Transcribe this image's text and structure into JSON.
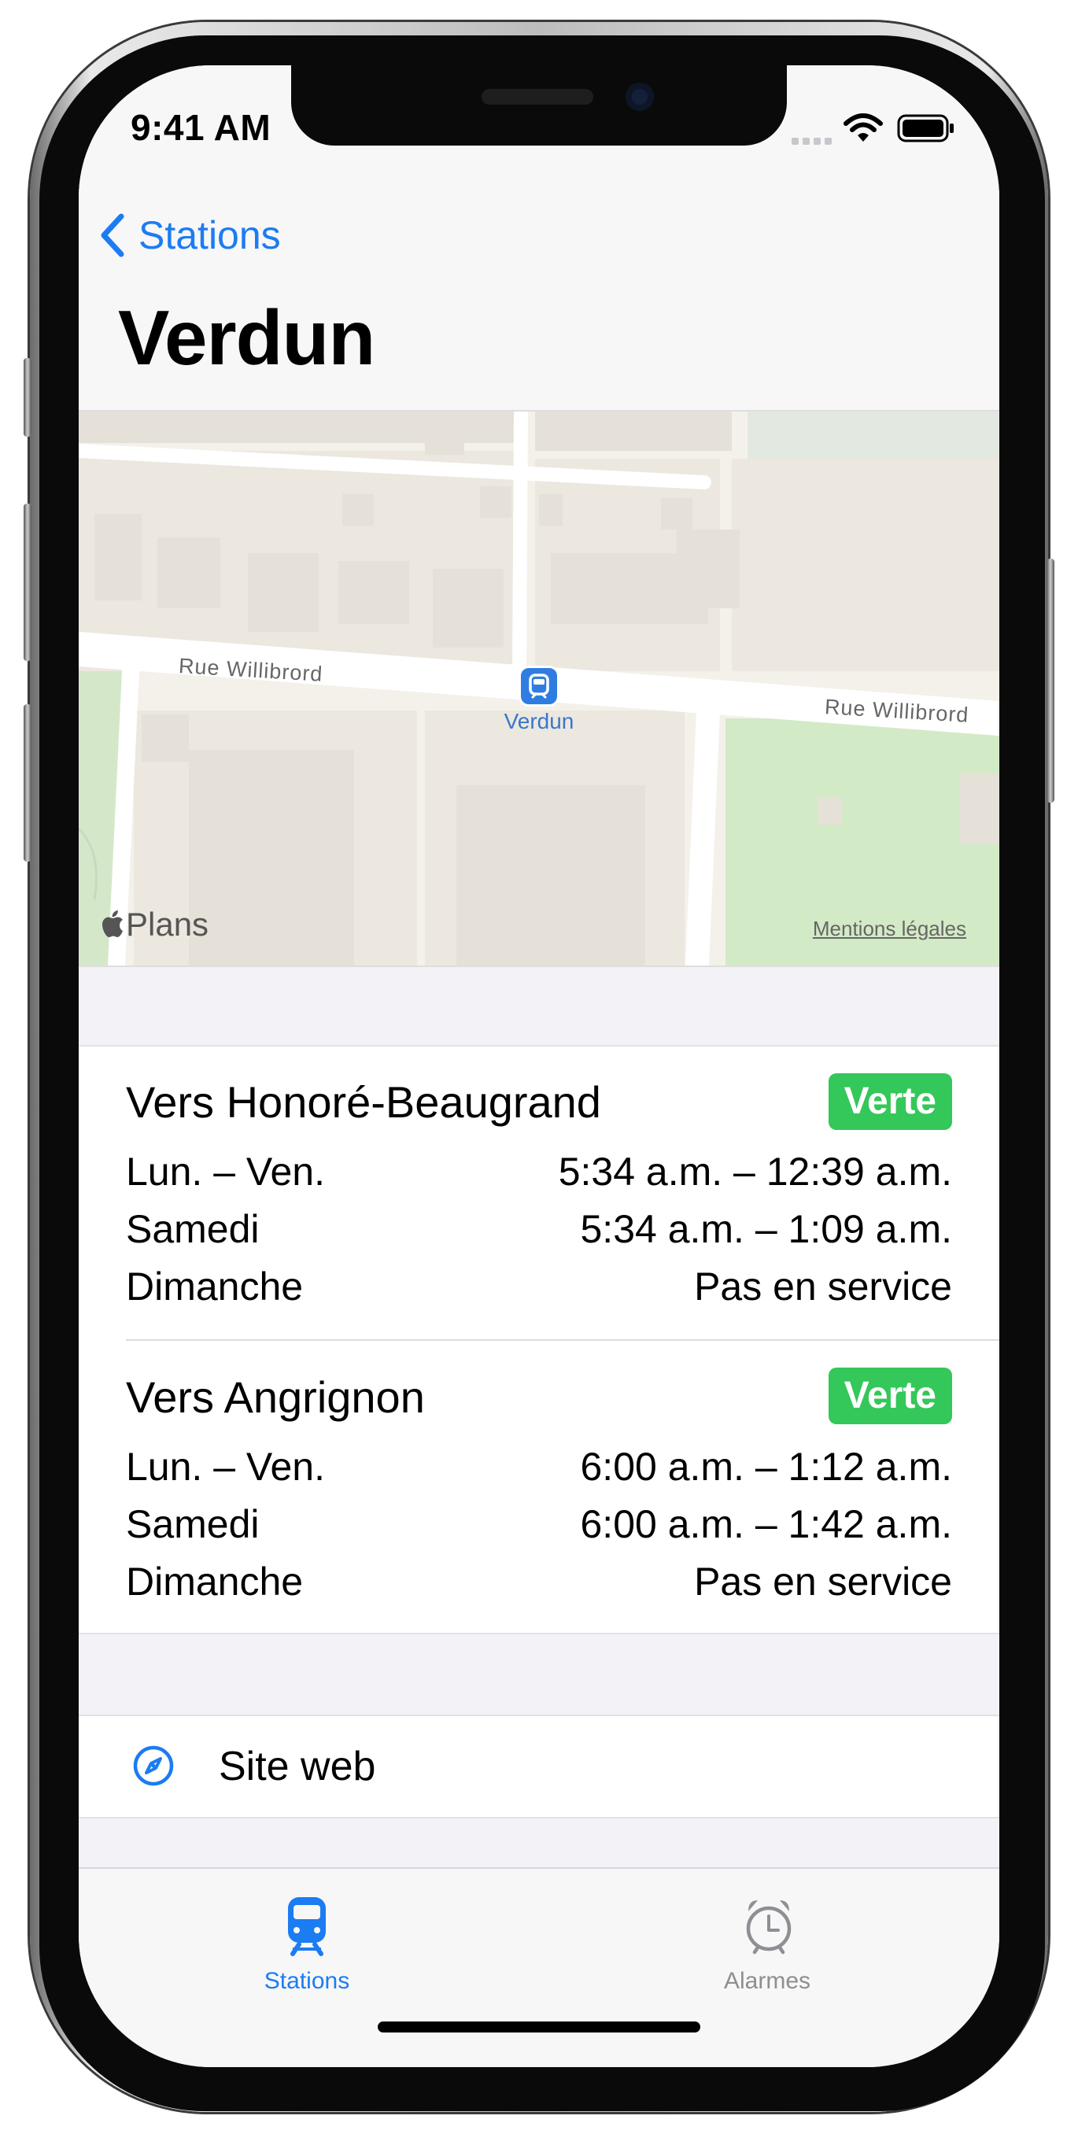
{
  "status_bar": {
    "time": "9:41 AM"
  },
  "nav": {
    "back_label": "Stations",
    "title": "Verdun"
  },
  "map": {
    "street_left": "Rue Willibrord",
    "street_right": "Rue Willibrord",
    "station_pin_label": "Verdun",
    "maps_logo_text": "Plans",
    "legal_link": "Mentions légales"
  },
  "schedules": [
    {
      "direction": "Vers Honoré-Beaugrand",
      "line": "Verte",
      "rows": [
        {
          "days": "Lun. – Ven.",
          "hours": "5:34 a.m. – 12:39 a.m."
        },
        {
          "days": "Samedi",
          "hours": "5:34 a.m. – 1:09 a.m."
        },
        {
          "days": "Dimanche",
          "hours": "Pas en service"
        }
      ]
    },
    {
      "direction": "Vers Angrignon",
      "line": "Verte",
      "rows": [
        {
          "days": "Lun. – Ven.",
          "hours": "6:00 a.m. – 1:12 a.m."
        },
        {
          "days": "Samedi",
          "hours": "6:00 a.m. – 1:42 a.m."
        },
        {
          "days": "Dimanche",
          "hours": "Pas en service"
        }
      ]
    }
  ],
  "links": {
    "website_label": "Site web"
  },
  "tabs": [
    {
      "label": "Stations",
      "icon": "train-icon",
      "selected": true
    },
    {
      "label": "Alarmes",
      "icon": "alarm-clock-icon",
      "selected": false
    }
  ],
  "colors": {
    "accent": "#1c7cf2",
    "line_green": "#34c759",
    "tab_inactive": "#8e8e93"
  }
}
